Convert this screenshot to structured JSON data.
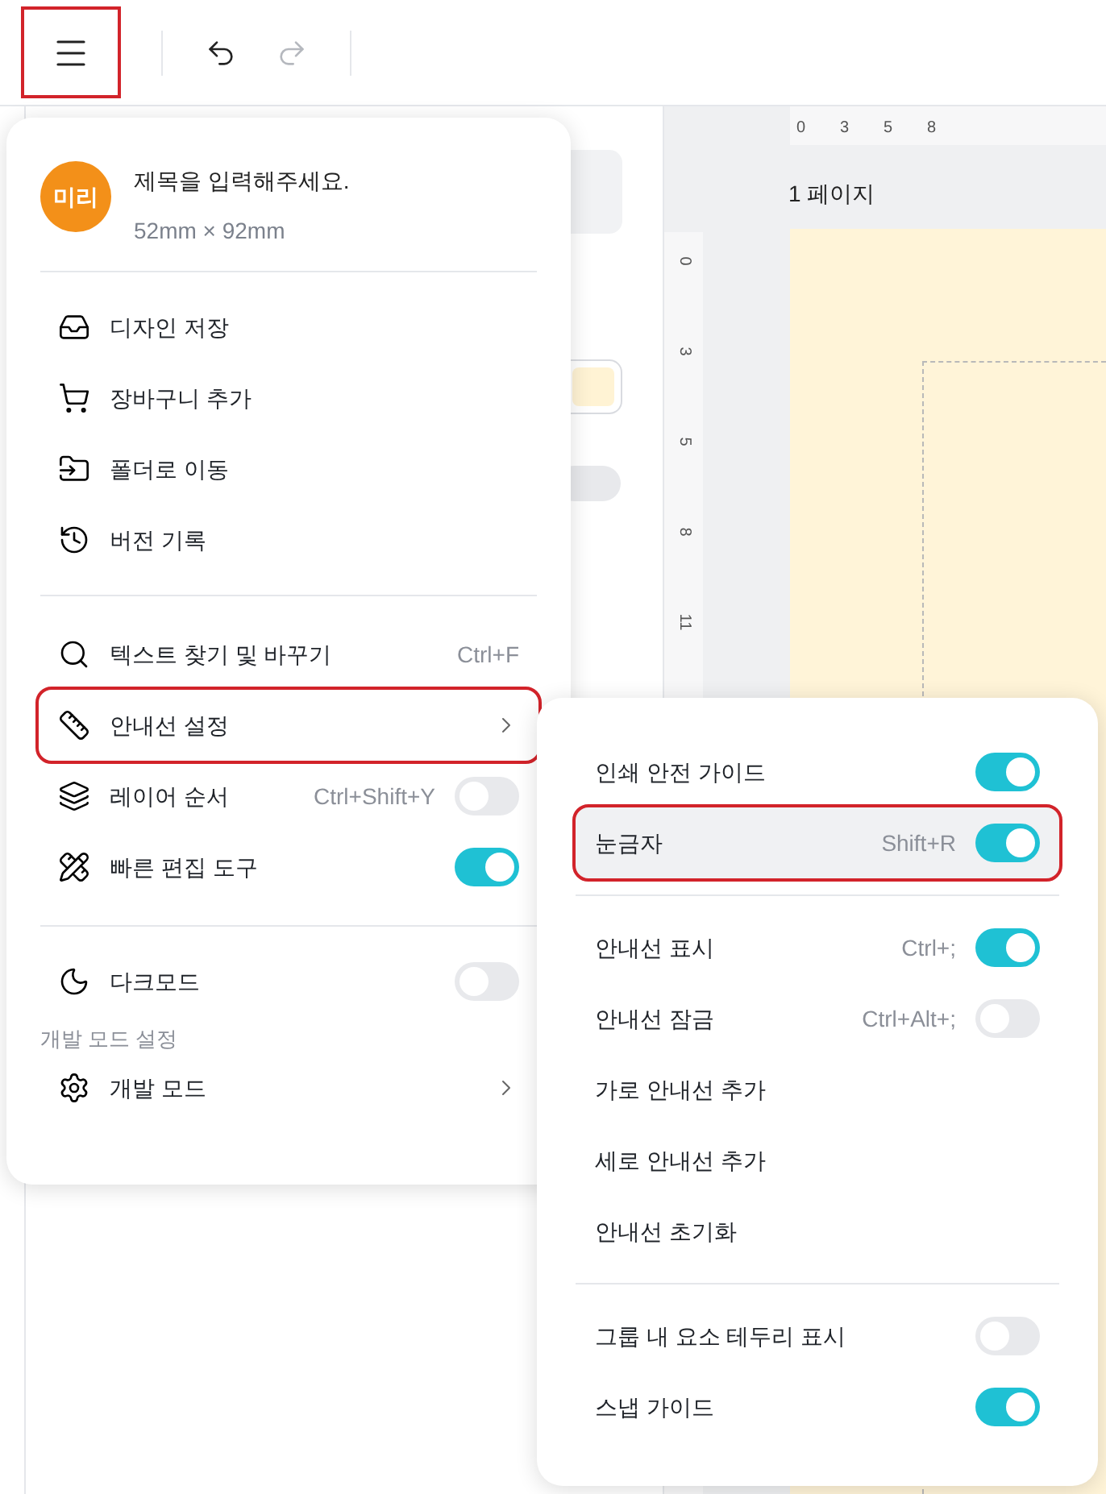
{
  "toolbar": {
    "buttons": [
      {
        "highlighted": true,
        "disabled": false
      },
      {
        "highlighted": false,
        "disabled": false
      },
      {
        "highlighted": false,
        "disabled": true
      }
    ]
  },
  "side_panel": {
    "toggle_on": false
  },
  "canvas": {
    "page_label": "1 페이지",
    "top_ruler": [
      "0",
      "3",
      "5",
      "8"
    ],
    "left_ruler": [
      "0",
      "3",
      "5",
      "8",
      "11"
    ]
  },
  "menu": {
    "avatar": "미리",
    "title": "제목을 입력해주세요.",
    "size": "52mm × 92mm",
    "sections": [
      {
        "items": [
          {
            "kind": "action",
            "label": "디자인 저장",
            "highlighted": false
          },
          {
            "kind": "action",
            "label": "장바구니 추가",
            "highlighted": false
          },
          {
            "kind": "action",
            "label": "폴더로 이동",
            "highlighted": false
          },
          {
            "kind": "action",
            "label": "버전 기록",
            "highlighted": false
          }
        ]
      },
      {
        "items": [
          {
            "kind": "action",
            "label": "텍스트 찾기 및 바꾸기",
            "shortcut": "Ctrl+F",
            "highlighted": false
          },
          {
            "kind": "submenu",
            "label": "안내선 설정",
            "highlighted": true
          },
          {
            "kind": "toggle",
            "label": "레이어 순서",
            "shortcut": "Ctrl+Shift+Y",
            "on": false,
            "highlighted": false
          },
          {
            "kind": "toggle",
            "label": "빠른 편집 도구",
            "on": true,
            "highlighted": false
          }
        ]
      },
      {
        "items": [
          {
            "kind": "toggle",
            "label": "다크모드",
            "on": false,
            "highlighted": false
          },
          {
            "kind": "heading",
            "label": "개발 모드 설정"
          },
          {
            "kind": "submenu",
            "label": "개발 모드",
            "highlighted": false
          }
        ]
      }
    ]
  },
  "submenu": {
    "sections": [
      {
        "items": [
          {
            "kind": "toggle",
            "label": "인쇄 안전 가이드",
            "on": true,
            "highlighted": false
          },
          {
            "kind": "toggle",
            "label": "눈금자",
            "shortcut": "Shift+R",
            "on": true,
            "highlighted": true
          }
        ]
      },
      {
        "items": [
          {
            "kind": "toggle",
            "label": "안내선 표시",
            "shortcut": "Ctrl+;",
            "on": true,
            "highlighted": false
          },
          {
            "kind": "toggle",
            "label": "안내선 잠금",
            "shortcut": "Ctrl+Alt+;",
            "on": false,
            "highlighted": false
          },
          {
            "kind": "action",
            "label": "가로 안내선 추가",
            "highlighted": false
          },
          {
            "kind": "action",
            "label": "세로 안내선 추가",
            "highlighted": false
          },
          {
            "kind": "action",
            "label": "안내선 초기화",
            "highlighted": false
          }
        ]
      },
      {
        "items": [
          {
            "kind": "toggle",
            "label": "그룹 내 요소 테두리 표시",
            "on": false,
            "highlighted": false
          },
          {
            "kind": "toggle",
            "label": "스냅 가이드",
            "on": true,
            "highlighted": false
          }
        ]
      }
    ]
  }
}
